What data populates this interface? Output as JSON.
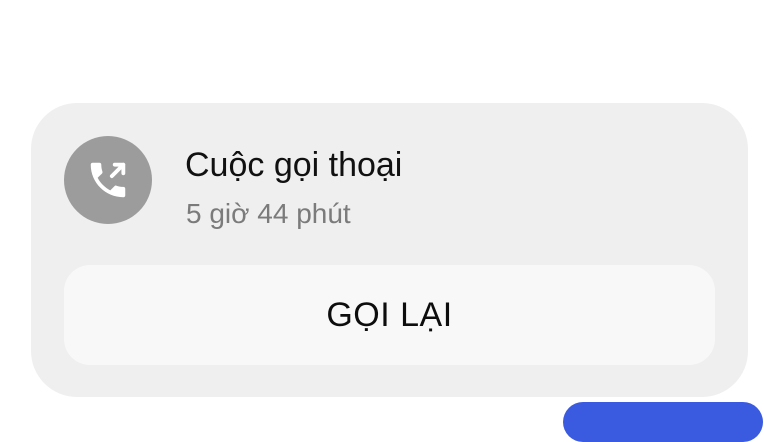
{
  "call_message": {
    "title": "Cuộc gọi thoại",
    "duration": "5 giờ 44 phút",
    "icon": "outgoing-call-icon",
    "callback_label": "GỌI LẠI"
  },
  "colors": {
    "card_background": "#efefef",
    "icon_circle": "#9c9c9c",
    "button_background": "#f8f8f8",
    "sent_bubble": "#3a5be0"
  }
}
